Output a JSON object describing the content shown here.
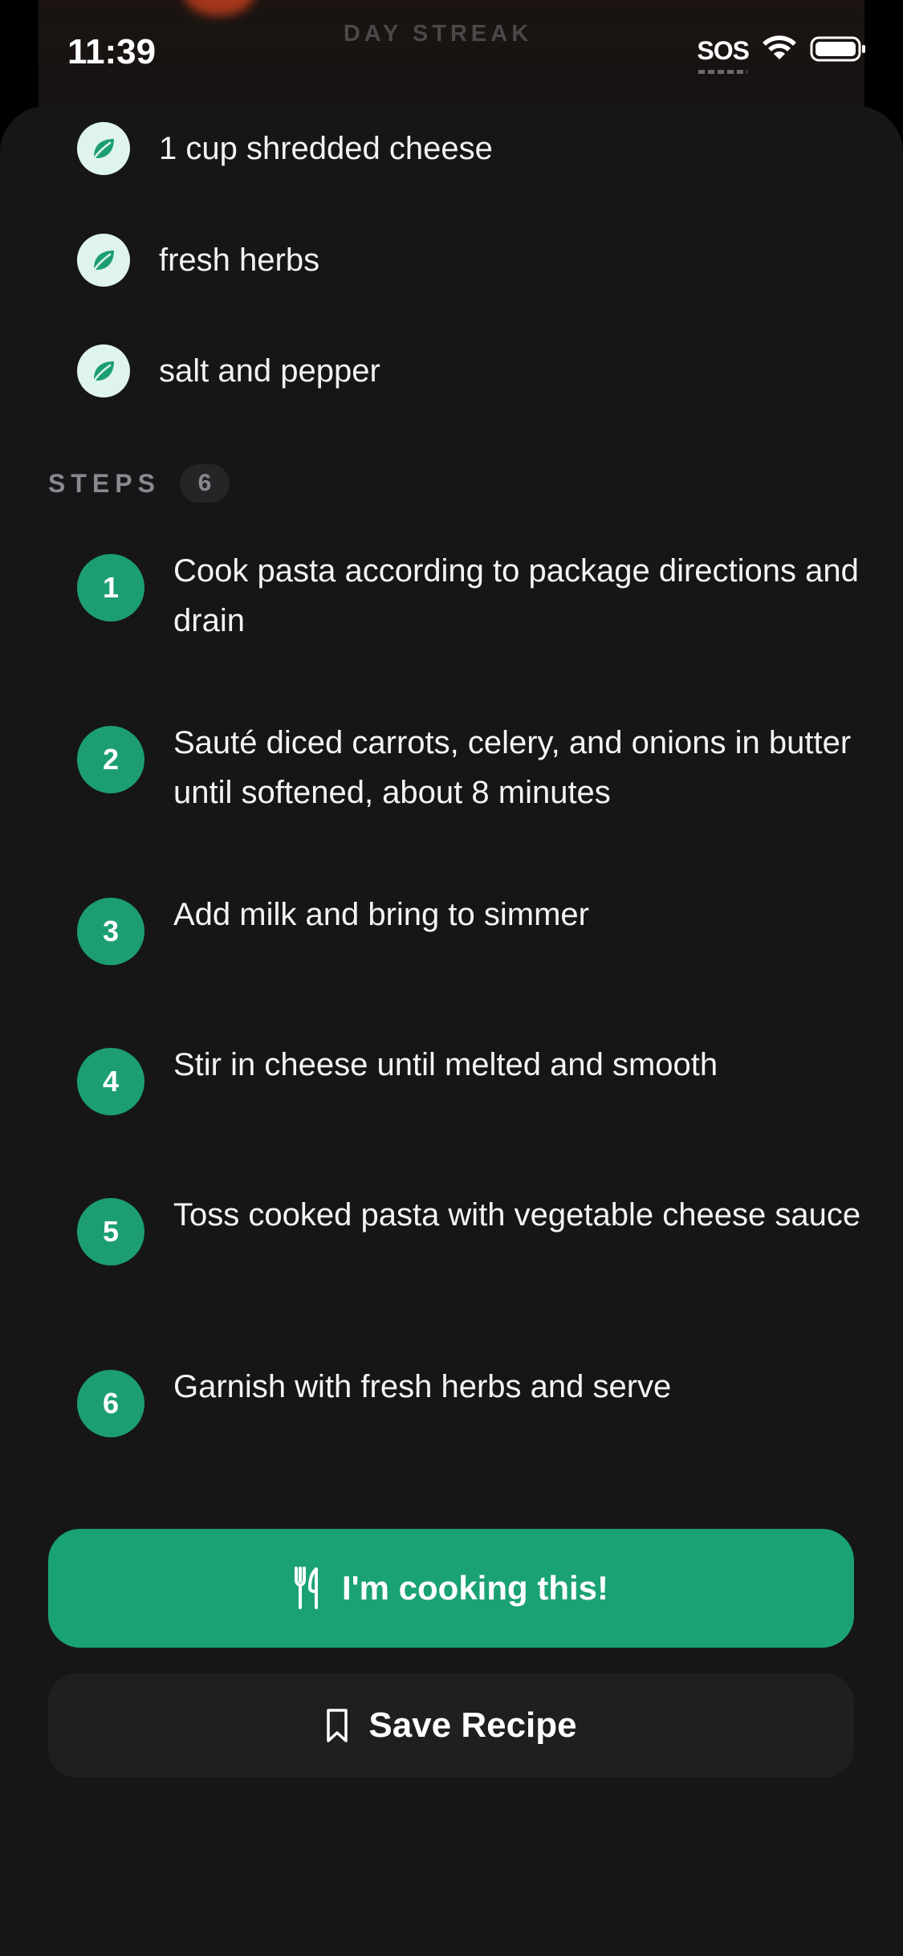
{
  "status_bar": {
    "time": "11:39",
    "sos": "SOS"
  },
  "background": {
    "label": "DAY STREAK"
  },
  "ingredients": [
    {
      "text": "1 cup shredded cheese",
      "icon": "leaf-icon"
    },
    {
      "text": "fresh herbs",
      "icon": "leaf-icon"
    },
    {
      "text": "salt and pepper",
      "icon": "leaf-icon"
    }
  ],
  "steps_section": {
    "label": "STEPS",
    "count": "6"
  },
  "steps": [
    {
      "number": "1",
      "text": "Cook pasta according to package directions and drain"
    },
    {
      "number": "2",
      "text": "Sauté diced carrots, celery, and onions in butter until softened, about 8 minutes"
    },
    {
      "number": "3",
      "text": "Add milk and bring to simmer"
    },
    {
      "number": "4",
      "text": "Stir in cheese until melted and smooth"
    },
    {
      "number": "5",
      "text": "Toss cooked pasta with vegetable cheese sauce"
    },
    {
      "number": "6",
      "text": "Garnish with fresh herbs and serve"
    }
  ],
  "actions": {
    "cook_label": "I'm cooking this!",
    "cook_icon": "fork-knife-icon",
    "save_label": "Save Recipe",
    "save_icon": "bookmark-icon"
  },
  "colors": {
    "accent": "#1ba273",
    "sheet": "#161618",
    "leaf_badge": "#dff5ec"
  }
}
